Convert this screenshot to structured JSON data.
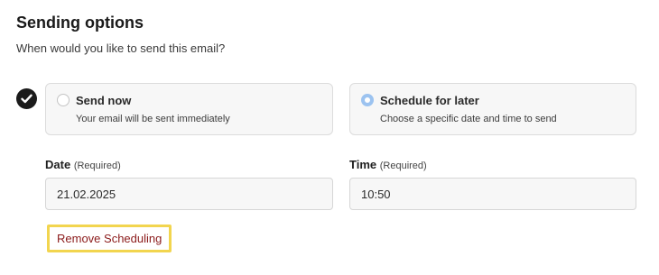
{
  "section": {
    "title": "Sending options",
    "subtitle": "When would you like to send this email?"
  },
  "step_icon": "check-icon",
  "options": [
    {
      "label": "Send now",
      "description": "Your email will be sent immediately",
      "selected": false
    },
    {
      "label": "Schedule for later",
      "description": "Choose a specific date and time to send",
      "selected": true
    }
  ],
  "date": {
    "label": "Date",
    "required": "(Required)",
    "value": "21.02.2025"
  },
  "time": {
    "label": "Time",
    "required": "(Required)",
    "value": "10:50"
  },
  "actions": {
    "remove_label": "Remove Scheduling"
  },
  "colors": {
    "radio_selected": "#9cc3f0",
    "remove_text": "#8b1a1a",
    "highlight_border": "#f2d54f"
  }
}
